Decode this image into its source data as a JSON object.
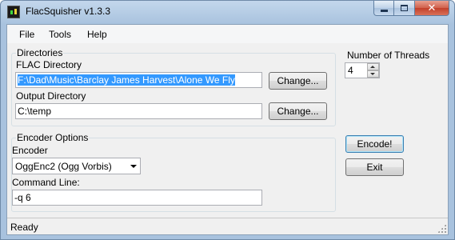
{
  "window": {
    "title": "FlacSquisher v1.3.3",
    "close_glyph": "✕"
  },
  "menu": [
    "File",
    "Tools",
    "Help"
  ],
  "directories": {
    "group_label": "Directories",
    "flac_label": "FLAC Directory",
    "flac_value": "F:\\Dad\\Music\\Barclay James Harvest\\Alone We Fly",
    "flac_change": "Change...",
    "output_label": "Output Directory",
    "output_value": "C:\\temp",
    "output_change": "Change..."
  },
  "threads": {
    "label": "Number of Threads",
    "value": "4"
  },
  "encoder_options": {
    "group_label": "Encoder Options",
    "encoder_label": "Encoder",
    "encoder_value": "OggEnc2 (Ogg Vorbis)",
    "command_label": "Command Line:",
    "command_value": "-q 6"
  },
  "actions": {
    "encode": "Encode!",
    "exit": "Exit"
  },
  "status": {
    "text": "Ready"
  },
  "colors": {
    "selection": "#3399ff",
    "close_button": "#c2402a",
    "frame": "#a8c2de"
  }
}
